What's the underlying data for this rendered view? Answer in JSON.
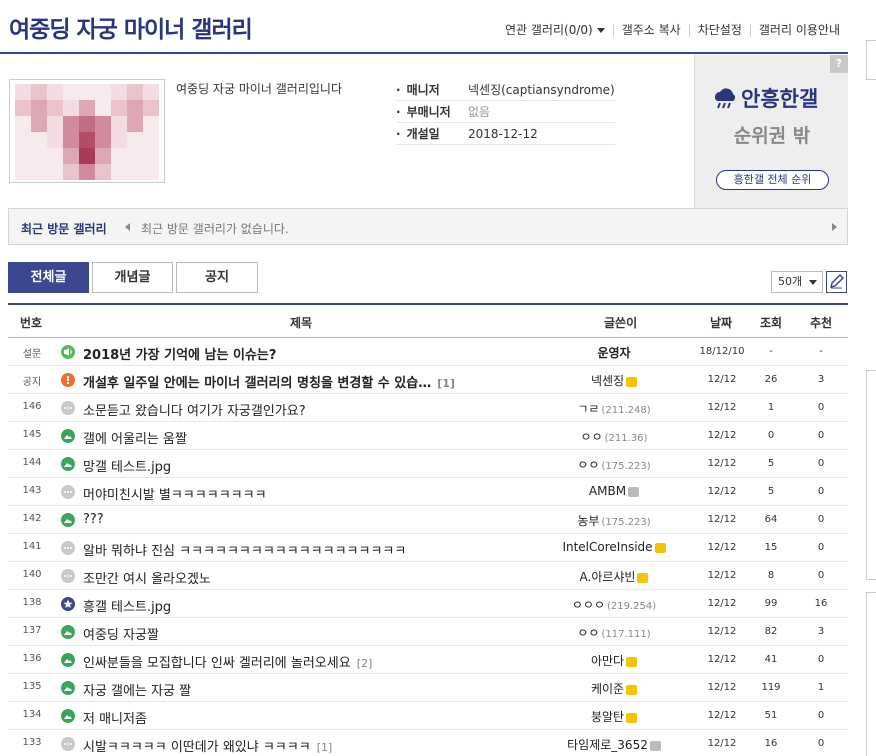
{
  "header": {
    "title": "여중딩 자궁 마이너 갤러리",
    "links": [
      "연관 갤러리(0/0)",
      "갤주소 복사",
      "차단설정",
      "갤러리 이용안내"
    ]
  },
  "info": {
    "intro": "여중딩 자궁 마이너 갤러리입니다",
    "meta": [
      {
        "key": "매니저",
        "value": "넥센징(captiansyndrome)"
      },
      {
        "key": "부매니저",
        "value": "없음"
      },
      {
        "key": "개설일",
        "value": "2018-12-12"
      }
    ]
  },
  "rank": {
    "help": "?",
    "logo": "안흥한갤",
    "status": "순위권 밖",
    "button": "흥한갤 전체 순위"
  },
  "recent": {
    "label": "최근 방문 갤러리",
    "message": "최근 방문 갤러리가 없습니다."
  },
  "tabs": [
    "전체글",
    "개념글",
    "공지"
  ],
  "list_count": "50개",
  "columns": {
    "num": "번호",
    "title": "제목",
    "writer": "글쓴이",
    "date": "날짜",
    "views": "조회",
    "rec": "추천"
  },
  "rows": [
    {
      "num": "설문",
      "type": "survey",
      "title": "2018년 가장 기억에 남는 이슈는?",
      "reply": "",
      "writer": "운영자",
      "ip": "",
      "badge": "",
      "date": "18/12/10",
      "views": "-",
      "rec": "-"
    },
    {
      "num": "공지",
      "type": "notice",
      "title": "개설후 일주일 안에는 마이너 갤러리의 명칭을 변경할 수 있습…",
      "reply": "[1]",
      "writer": "넥센징",
      "ip": "",
      "badge": "half",
      "date": "12/12",
      "views": "26",
      "rec": "3"
    },
    {
      "num": "146",
      "type": "text",
      "title": "소문듣고 왔습니다 여기가 자궁갤인가요?",
      "reply": "",
      "writer": "ㄱㄹ",
      "ip": "(211.248)",
      "badge": "",
      "date": "12/12",
      "views": "1",
      "rec": "0"
    },
    {
      "num": "145",
      "type": "image",
      "title": "갤에 어울리는 움짤",
      "reply": "",
      "writer": "ㅇㅇ",
      "ip": "(211.36)",
      "badge": "",
      "date": "12/12",
      "views": "0",
      "rec": "0"
    },
    {
      "num": "144",
      "type": "image",
      "title": "망갤 테스트.jpg",
      "reply": "",
      "writer": "ㅇㅇ",
      "ip": "(175.223)",
      "badge": "",
      "date": "12/12",
      "views": "5",
      "rec": "0"
    },
    {
      "num": "143",
      "type": "text",
      "title": "머야미친시발 별ㅋㅋㅋㅋㅋㅋㅋㅋ",
      "reply": "",
      "writer": "AMBM",
      "ip": "",
      "badge": "fix",
      "date": "12/12",
      "views": "5",
      "rec": "0"
    },
    {
      "num": "142",
      "type": "image",
      "title": "???",
      "reply": "",
      "writer": "농부",
      "ip": "(175.223)",
      "badge": "",
      "date": "12/12",
      "views": "64",
      "rec": "0"
    },
    {
      "num": "141",
      "type": "text",
      "title": "알바 뭐하냐 진심 ㅋㅋㅋㅋㅋㅋㅋㅋㅋㅋㅋㅋㅋㅋㅋㅋㅋㅋㅋ",
      "reply": "",
      "writer": "IntelCoreInside",
      "ip": "",
      "badge": "half",
      "date": "12/12",
      "views": "15",
      "rec": "0"
    },
    {
      "num": "140",
      "type": "text",
      "title": "조만간 여시 올라오겠노",
      "reply": "",
      "writer": "A.아르샤빈",
      "ip": "",
      "badge": "half",
      "date": "12/12",
      "views": "8",
      "rec": "0"
    },
    {
      "num": "138",
      "type": "recommend",
      "title": "흥갤 테스트.jpg",
      "reply": "",
      "writer": "ㅇㅇㅇ",
      "ip": "(219.254)",
      "badge": "",
      "date": "12/12",
      "views": "99",
      "rec": "16"
    },
    {
      "num": "137",
      "type": "image",
      "title": "여중딩 자궁짤",
      "reply": "",
      "writer": "ㅇㅇ",
      "ip": "(117.111)",
      "badge": "",
      "date": "12/12",
      "views": "82",
      "rec": "3"
    },
    {
      "num": "136",
      "type": "image",
      "title": "인싸분들을 모집합니다 인싸 겔러리에 놀러오세요",
      "reply": "[2]",
      "writer": "아만다",
      "ip": "",
      "badge": "half",
      "date": "12/12",
      "views": "41",
      "rec": "0"
    },
    {
      "num": "135",
      "type": "image",
      "title": "자궁 갤에는 자궁 짤",
      "reply": "",
      "writer": "케이준",
      "ip": "",
      "badge": "half",
      "date": "12/12",
      "views": "119",
      "rec": "1"
    },
    {
      "num": "134",
      "type": "image",
      "title": "저 매니저좀",
      "reply": "",
      "writer": "붕알탄",
      "ip": "",
      "badge": "half",
      "date": "12/12",
      "views": "51",
      "rec": "0"
    },
    {
      "num": "133",
      "type": "text",
      "title": "시발ㅋㅋㅋㅋㅋ 이딴데가 왜있냐 ㅋㅋㅋㅋ",
      "reply": "[1]",
      "writer": "타임제로_3652",
      "ip": "",
      "badge": "fix",
      "date": "12/12",
      "views": "16",
      "rec": "0"
    }
  ]
}
